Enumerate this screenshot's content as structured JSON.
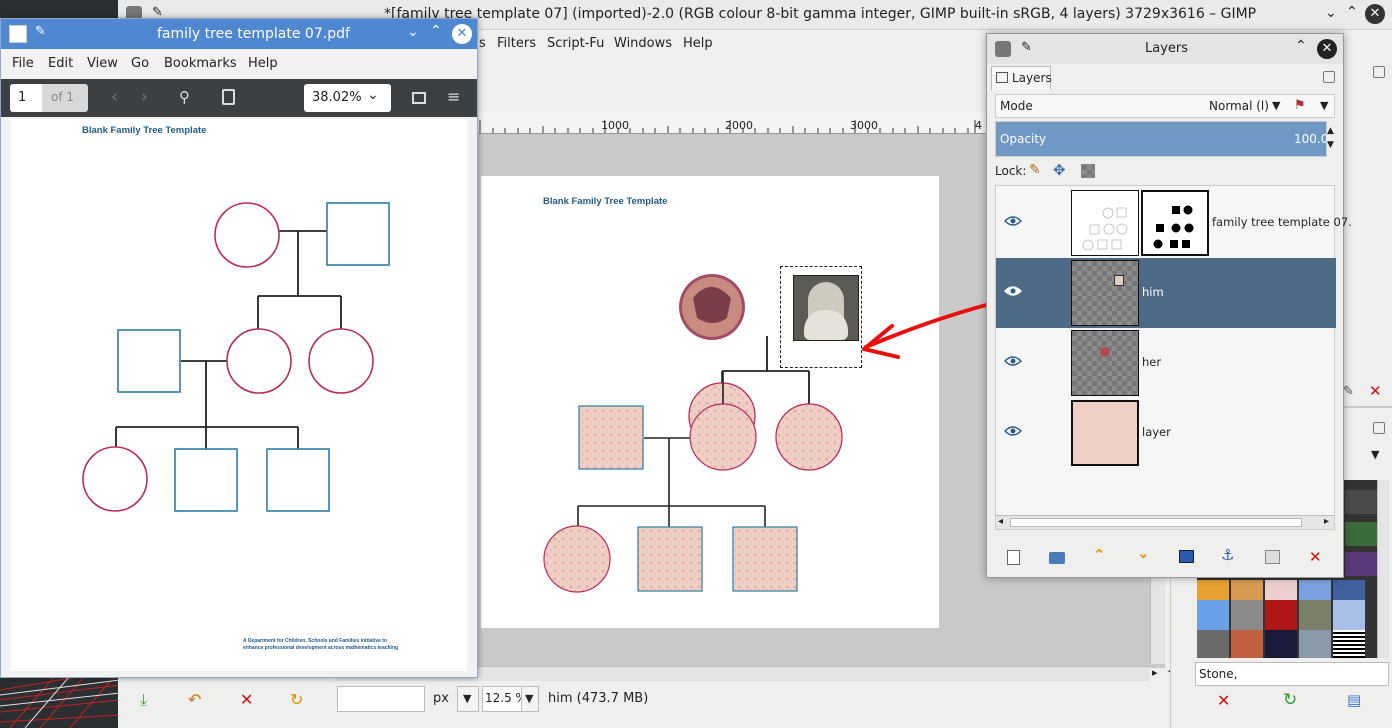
{
  "gimp": {
    "title": "*[family tree template 07] (imported)-2.0 (RGB colour 8-bit gamma integer, GIMP built-in sRGB, 4 layers) 3729x3616 – GIMP",
    "menu": [
      "s",
      "Filters",
      "Script-Fu",
      "Windows",
      "Help"
    ],
    "ruler_ticks": [
      "1000",
      "2000",
      "3000",
      "4"
    ],
    "status": {
      "unit": "px",
      "zoom": "12.5 %",
      "info": "him (473.7 MB)"
    },
    "pattern_name": "Stone,"
  },
  "canvas": {
    "template_title": "Blank Family Tree Template"
  },
  "evince": {
    "title": "family tree template 07.pdf",
    "menu": [
      "File",
      "Edit",
      "View",
      "Go",
      "Bookmarks",
      "Help"
    ],
    "page_current": "1",
    "page_total": "of 1",
    "zoom": "38.02%",
    "doc_title": "Blank Family Tree Template",
    "footer_line1": "A Department for Children, Schools and Families initiative to",
    "footer_line2": "enhance professional development across mathematics teaching"
  },
  "layers": {
    "title": "Layers",
    "tab": "Layers",
    "mode_label": "Mode",
    "mode_value": "Normal (l)",
    "opacity_label": "Opacity",
    "opacity_value": "100.0",
    "lock_label": "Lock:",
    "items": [
      {
        "name": "family tree template 07.",
        "selected": false
      },
      {
        "name": "him",
        "selected": true
      },
      {
        "name": "her",
        "selected": false
      },
      {
        "name": "layer",
        "selected": false
      }
    ]
  },
  "colors": {
    "accent": "#4f87d0",
    "selection": "#4d6a87",
    "annotation": "#e8100f",
    "magenta": "#b5305f",
    "teal": "#2e7fa3"
  }
}
